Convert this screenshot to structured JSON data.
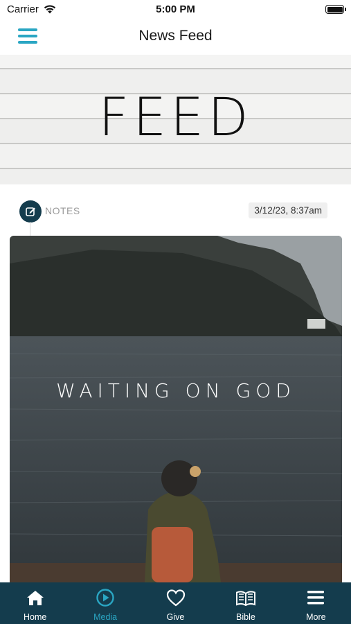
{
  "status_bar": {
    "carrier": "Carrier",
    "time": "5:00 PM"
  },
  "nav": {
    "title": "News Feed",
    "menu_icon": "hamburger-icon"
  },
  "banner": {
    "text": "FEED"
  },
  "post": {
    "type_label": "NOTES",
    "type_icon": "edit-note-icon",
    "timestamp": "3/12/23, 8:37am",
    "image_caption": "WAITING ON GOD"
  },
  "tabs": [
    {
      "label": "Home",
      "icon": "home-icon",
      "active": false
    },
    {
      "label": "Media",
      "icon": "play-circle-icon",
      "active": true
    },
    {
      "label": "Give",
      "icon": "heart-icon",
      "active": false
    },
    {
      "label": "Bible",
      "icon": "book-icon",
      "active": false
    },
    {
      "label": "More",
      "icon": "menu-icon",
      "active": false
    }
  ],
  "colors": {
    "accent": "#2aa6c3",
    "tab_bar_bg": "#143c4d",
    "tab_inactive": "#ffffff"
  }
}
